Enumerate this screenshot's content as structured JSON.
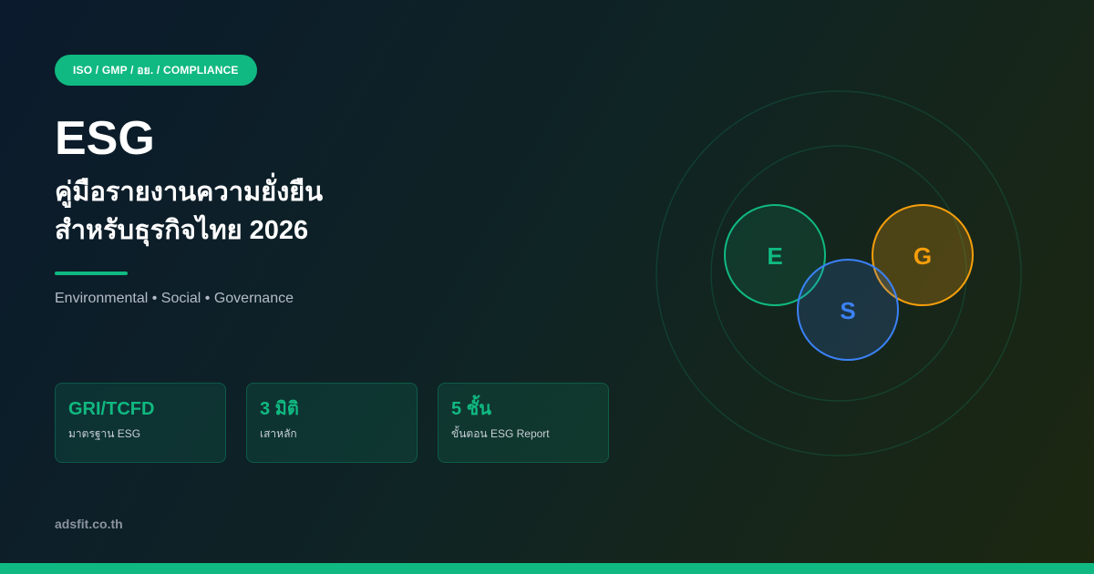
{
  "badge": {
    "text": "ISO / GMP / อย. / COMPLIANCE"
  },
  "hero": {
    "title": "ESG",
    "subtitle_line1": "คู่มือรายงานความยั่งยืน",
    "subtitle_line2": "สำหรับธุรกิจไทย 2026",
    "tagline": "Environmental • Social • Governance"
  },
  "stats": [
    {
      "value": "GRI/TCFD",
      "label": "มาตรฐาน ESG"
    },
    {
      "value": "3 มิติ",
      "label": "เสาหลัก"
    },
    {
      "value": "5 ชั้น",
      "label": "ขั้นตอน ESG Report"
    }
  ],
  "venn": {
    "e": {
      "letter": "E",
      "color": "#10b981"
    },
    "s": {
      "letter": "S",
      "color": "#3b82f6"
    },
    "g": {
      "letter": "G",
      "color": "#f59e0b"
    }
  },
  "footer": {
    "domain": "adsfit.co.th"
  },
  "colors": {
    "accent": "#10b981",
    "background": "#0b1a2c"
  }
}
